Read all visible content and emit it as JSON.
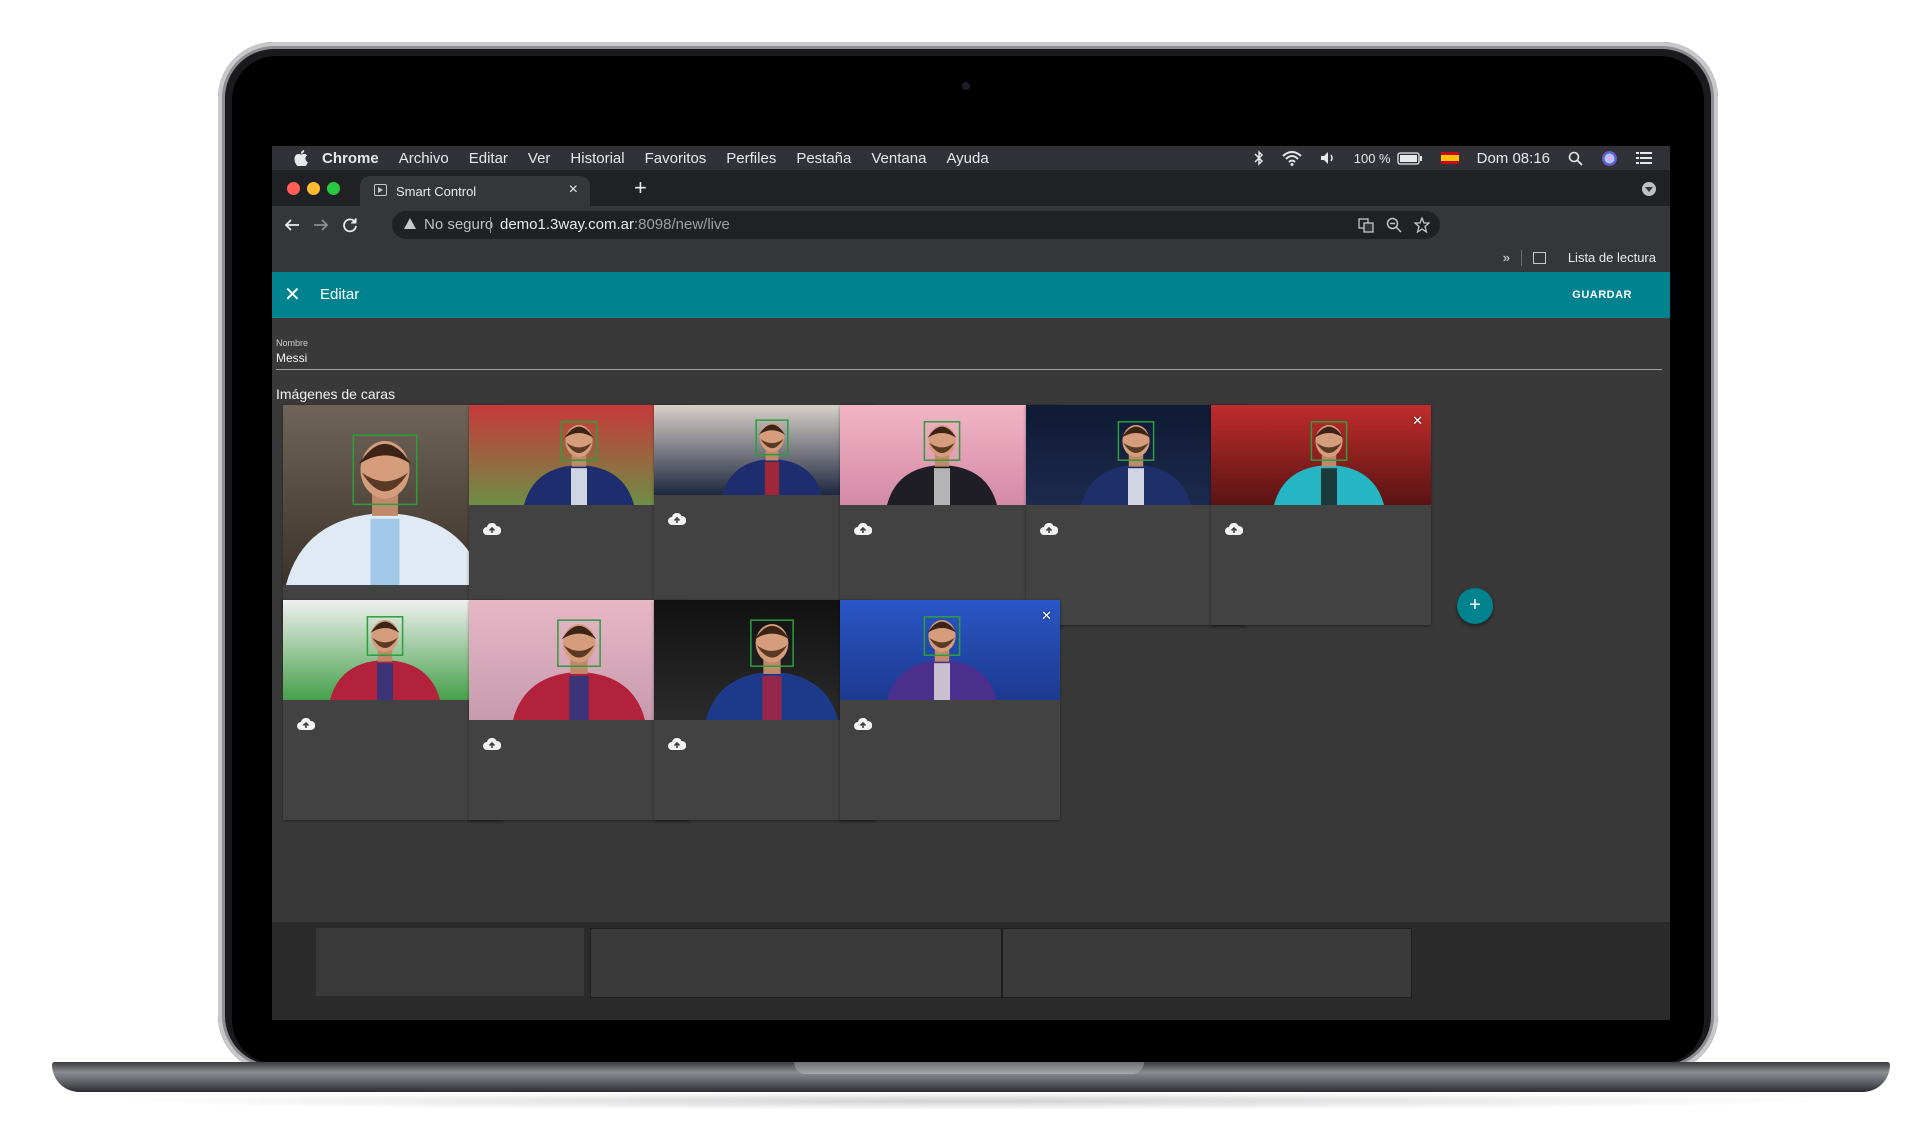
{
  "menubar": {
    "app": "Chrome",
    "items": [
      "Archivo",
      "Editar",
      "Ver",
      "Historial",
      "Favoritos",
      "Perfiles",
      "Pestaña",
      "Ventana",
      "Ayuda"
    ],
    "battery": "100 %",
    "clock": "Dom 08:16"
  },
  "browser": {
    "tab_title": "Smart Control",
    "security_label": "No seguro",
    "url_host": "demo1.3way.com.ar",
    "url_path": ":8098/new/live",
    "overflow": "»",
    "reading_list": "Lista de lectura"
  },
  "app": {
    "title": "Editar",
    "save_label": "GUARDAR",
    "field_label": "Nombre",
    "field_value": "Messi",
    "section_title": "Imágenes de caras"
  },
  "photos": [
    {
      "bg": [
        "#6f6457",
        "#3c332b"
      ],
      "shirt": "#dfeaf5",
      "stripe": "#8fc1e3"
    },
    {
      "bg": [
        "#c7393a",
        "#6e8e45"
      ],
      "shirt": "#1d2d6e",
      "stripe": "#ffffff"
    },
    {
      "bg": [
        "#d7d0c8",
        "#1f2740"
      ],
      "shirt": "#1d2d6e",
      "stripe": "#c0262d"
    },
    {
      "bg": [
        "#f2b5c5",
        "#d38aa6"
      ],
      "shirt": "#1e1e24",
      "stripe": "#d9d9d9"
    },
    {
      "bg": [
        "#0f1a33",
        "#1c2a4d"
      ],
      "shirt": "#1e2f6a",
      "stripe": "#ffffff"
    },
    {
      "bg": [
        "#c02c2c",
        "#5a1313"
      ],
      "shirt": "#26b5c2",
      "stripe": "#1a1a1a"
    },
    {
      "bg": [
        "#f0f0f0",
        "#46a04a"
      ],
      "shirt": "#b3223b",
      "stripe": "#1d3a8a"
    },
    {
      "bg": [
        "#e6b8c6",
        "#c79aae"
      ],
      "shirt": "#b3223b",
      "stripe": "#1d3a8a"
    },
    {
      "bg": [
        "#111111",
        "#2b2b2b"
      ],
      "shirt": "#1d3a8a",
      "stripe": "#b3223b"
    },
    {
      "bg": [
        "#2a56c6",
        "#1c3a8f"
      ],
      "shirt": "#4a2f8c",
      "stripe": "#e8e3df"
    }
  ],
  "colors": {
    "accent": "#00838f",
    "face_box": "#2e9e3c",
    "card": "#424242"
  },
  "icons": [
    "apple-icon",
    "bluetooth-icon",
    "wifi-icon",
    "volume-icon",
    "battery-icon",
    "flag-icon",
    "search-icon",
    "siri-icon",
    "control-center-icon",
    "close-icon",
    "upload-icon",
    "add-icon",
    "star-icon",
    "zoom-icon",
    "translate-icon",
    "reload-icon",
    "back-icon",
    "forward-icon"
  ]
}
